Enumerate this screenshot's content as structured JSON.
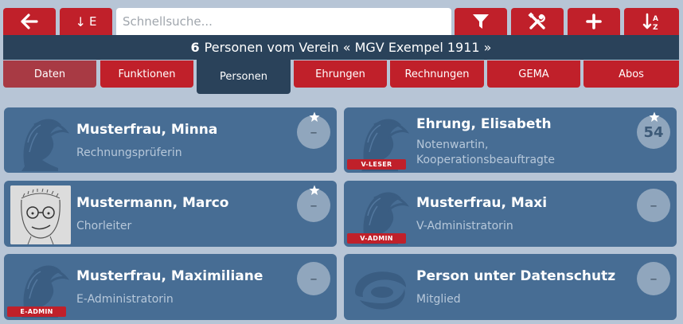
{
  "toolbar": {
    "back_icon": "arrow-left-icon",
    "sort_button": {
      "arrow": "↓",
      "letter": "E"
    },
    "search_placeholder": "Schnellsuche...",
    "filter_icon": "filter-icon",
    "tools_icon": "tools-icon",
    "add_icon": "plus-icon",
    "sort_az_icon": "sort-az-icon",
    "accent_color": "#c0202a"
  },
  "title": {
    "count": "6",
    "text": "Personen vom Verein « MGV Exempel 1911 »"
  },
  "tabs": [
    {
      "label": "Daten",
      "state": "dimmed"
    },
    {
      "label": "Funktionen",
      "state": "normal"
    },
    {
      "label": "Personen",
      "state": "active"
    },
    {
      "label": "Ehrungen",
      "state": "normal"
    },
    {
      "label": "Rechnungen",
      "state": "normal"
    },
    {
      "label": "GEMA",
      "state": "normal"
    },
    {
      "label": "Abos",
      "state": "normal"
    }
  ],
  "persons": [
    {
      "name": "Musterfrau, Minna",
      "role": "Rechnungsprüferin",
      "badge": "",
      "action": "–",
      "starred": true,
      "avatar": "woman-silhouette"
    },
    {
      "name": "Ehrung, Elisabeth",
      "role": "Notenwartin, Kooperationsbeauftragte",
      "badge": "V-LESER",
      "action": "54",
      "starred": true,
      "avatar": "woman-silhouette"
    },
    {
      "name": "Mustermann, Marco",
      "role": "Chorleiter",
      "badge": "",
      "action": "–",
      "starred": true,
      "avatar": "drawn-face-photo"
    },
    {
      "name": "Musterfrau, Maxi",
      "role": "V-Administratorin",
      "badge": "V-ADMIN",
      "action": "–",
      "starred": false,
      "avatar": "woman-silhouette"
    },
    {
      "name": "Musterfrau, Maximiliane",
      "role": "E-Administratorin",
      "badge": "E-ADMIN",
      "action": "–",
      "starred": false,
      "avatar": "woman-silhouette"
    },
    {
      "name": "Person unter Datenschutz",
      "role": "Mitglied",
      "badge": "",
      "action": "–",
      "starred": false,
      "avatar": "privacy-swirl"
    }
  ]
}
